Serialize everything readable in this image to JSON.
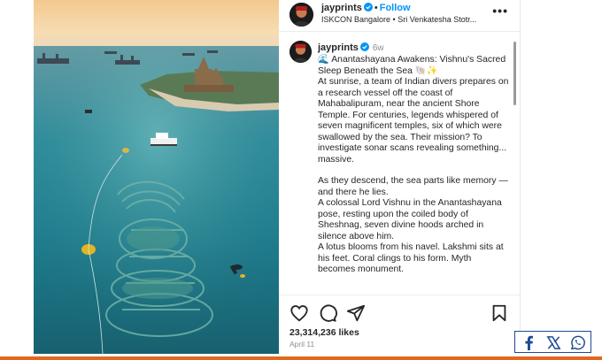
{
  "post": {
    "username": "jayprints",
    "follow_label": "Follow",
    "location": "ISKCON Bangalore • Sri Venkatesha Stotr...",
    "more_label": "•••",
    "time_ago": "6w",
    "caption": [
      "🌊 Anantashayana Awakens: Vishnu's Sacred Sleep Beneath the Sea 🐚✨",
      "At sunrise, a team of Indian divers prepares on a research vessel off the coast of Mahabalipuram, near the ancient Shore Temple. For centuries, legends whispered of seven magnificent temples, six of which were swallowed by the sea. Their mission? To investigate sonar scans revealing something... massive.",
      "As they descend, the sea parts like memory — and there he lies.",
      "A colossal Lord Vishnu in the Anantashayana pose, resting upon the coiled body of Sheshnag, seven divine hoods arched in silence above him.",
      "A lotus blooms from his navel. Lakshmi sits at his feet. Coral clings to his form. Myth becomes monument."
    ],
    "likes": "23,314,236 likes",
    "date": "April 11"
  },
  "colors": {
    "follow": "#0095f6",
    "verified": "#0095f6",
    "share_border": "#1d4a93",
    "bottom_bar": "#e0691f"
  },
  "icons": {
    "actions": [
      "heart-icon",
      "comment-icon",
      "share-send-icon",
      "bookmark-icon"
    ],
    "share": [
      "facebook-icon",
      "x-icon",
      "whatsapp-icon"
    ]
  }
}
